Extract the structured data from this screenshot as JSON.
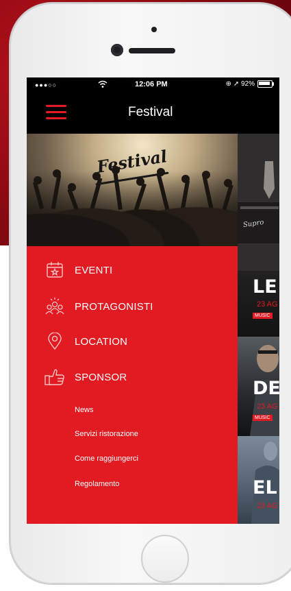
{
  "status_bar": {
    "signal": "●●●○○",
    "time": "12:06 PM",
    "battery_text": "⊕ ➚ 92%"
  },
  "nav": {
    "title": "Festival"
  },
  "hero": {
    "logo_text": "Festival"
  },
  "menu": {
    "main_items": [
      {
        "label": "EVENTI",
        "icon": "calendar-star-icon"
      },
      {
        "label": "PROTAGONISTI",
        "icon": "people-group-icon"
      },
      {
        "label": "LOCATION",
        "icon": "location-pin-icon"
      },
      {
        "label": "SPONSOR",
        "icon": "thumbs-up-icon"
      }
    ],
    "sub_items": [
      "News",
      "Servizi ristorazione",
      "Come raggiungerci",
      "Regolamento"
    ]
  },
  "cards": [
    {
      "title": "LE",
      "date": "23 AG",
      "tag": "MUSIC",
      "amp_brand": "Supro"
    },
    {
      "title": "DE",
      "date": "23 AG",
      "tag": "MUSIC"
    },
    {
      "title": "EL",
      "date": "23 AG"
    }
  ],
  "colors": {
    "accent": "#e21b23",
    "bar": "#000000"
  }
}
